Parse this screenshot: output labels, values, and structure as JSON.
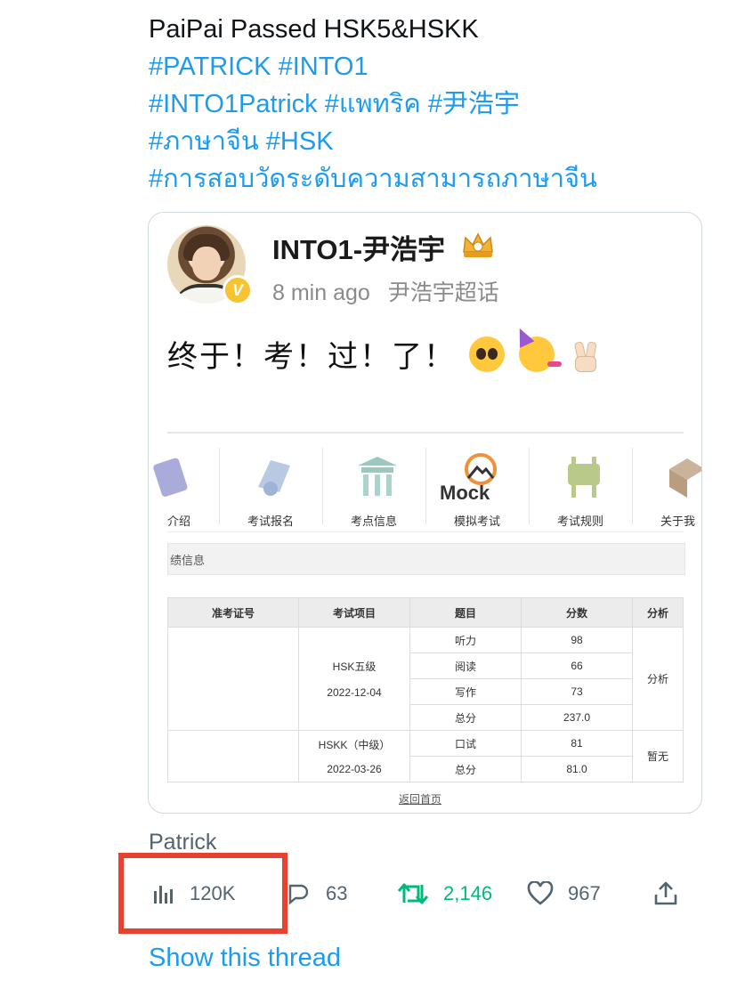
{
  "tweet": {
    "text_line1": "PaiPai Passed HSK5&HSKK",
    "hashtag_lines": [
      "#PATRICK #INTO1",
      "#INTO1Patrick #แพทริค #尹浩宇",
      "#ภาษาจีน #HSK",
      "#การสอบวัดระดับความสามารถภาษาจีน"
    ],
    "author": "Patrick",
    "show_thread": "Show this thread"
  },
  "quote": {
    "account_name": "INTO1-尹浩宇",
    "verified_letter": "V",
    "time_ago": "8 min ago",
    "topic": "尹浩宇超话",
    "post_text": "终于！考！过！了！",
    "nav_items": [
      "介绍",
      "考试报名",
      "考点信息",
      "模拟考试",
      "考试规则",
      "关于我"
    ],
    "mock_logo": "Mock",
    "section_title": "绩信息",
    "table": {
      "headers": [
        "准考证号",
        "考试项目",
        "题目",
        "分数",
        "分析"
      ],
      "hsk_exam": "HSK五级",
      "hsk_date": "2022-12-04",
      "hsk_rows": [
        {
          "item": "听力",
          "score": "98"
        },
        {
          "item": "阅读",
          "score": "66"
        },
        {
          "item": "写作",
          "score": "73"
        },
        {
          "item": "总分",
          "score": "237.0"
        }
      ],
      "hsk_analysis": "分析",
      "hskk_exam": "HSKK（中级）",
      "hskk_date": "2022-03-26",
      "hskk_rows": [
        {
          "item": "口试",
          "score": "81"
        },
        {
          "item": "总分",
          "score": "81.0"
        }
      ],
      "hskk_analysis": "暂无"
    },
    "back_link": "返回首页"
  },
  "actions": {
    "views": "120K",
    "replies": "63",
    "retweets": "2,146",
    "likes": "967"
  },
  "colors": {
    "link_blue": "#1d9bf0",
    "retweet_green": "#00ba7c",
    "highlight_red": "#e8412f",
    "muted_gray": "#536471"
  }
}
